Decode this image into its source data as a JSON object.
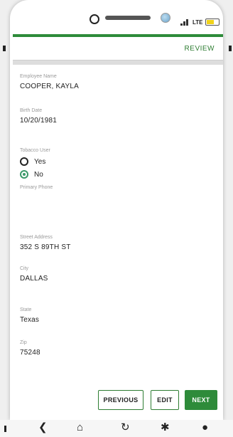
{
  "status_bar": {
    "network_label": "LTE"
  },
  "header": {
    "review_link": "REVIEW"
  },
  "form": {
    "employee_name": {
      "label": "Employee Name",
      "value": "COOPER, KAYLA"
    },
    "birth_date": {
      "label": "Birth Date",
      "value": "10/20/1981"
    },
    "tobacco_user": {
      "label": "Tobacco User",
      "options": [
        {
          "label": "Yes",
          "selected": false
        },
        {
          "label": "No",
          "selected": true
        }
      ]
    },
    "primary_phone": {
      "label": "Primary Phone",
      "value": ""
    },
    "street_address": {
      "label": "Street Address",
      "value": "352 S 89TH ST"
    },
    "city": {
      "label": "City",
      "value": "DALLAS"
    },
    "state": {
      "label": "State",
      "value": "Texas"
    },
    "zip": {
      "label": "Zip",
      "value": "75248"
    }
  },
  "actions": {
    "previous_label": "PREVIOUS",
    "edit_label": "EDIT",
    "next_label": "NEXT"
  },
  "nav_bar": {
    "icons": [
      "back-icon",
      "home-icon",
      "refresh-icon",
      "settings-icon",
      "profile-icon"
    ]
  },
  "colors": {
    "accent_green": "#2e8b3a",
    "radio_selected": "#3b9a6a",
    "label_gray": "#9a9a9a"
  }
}
